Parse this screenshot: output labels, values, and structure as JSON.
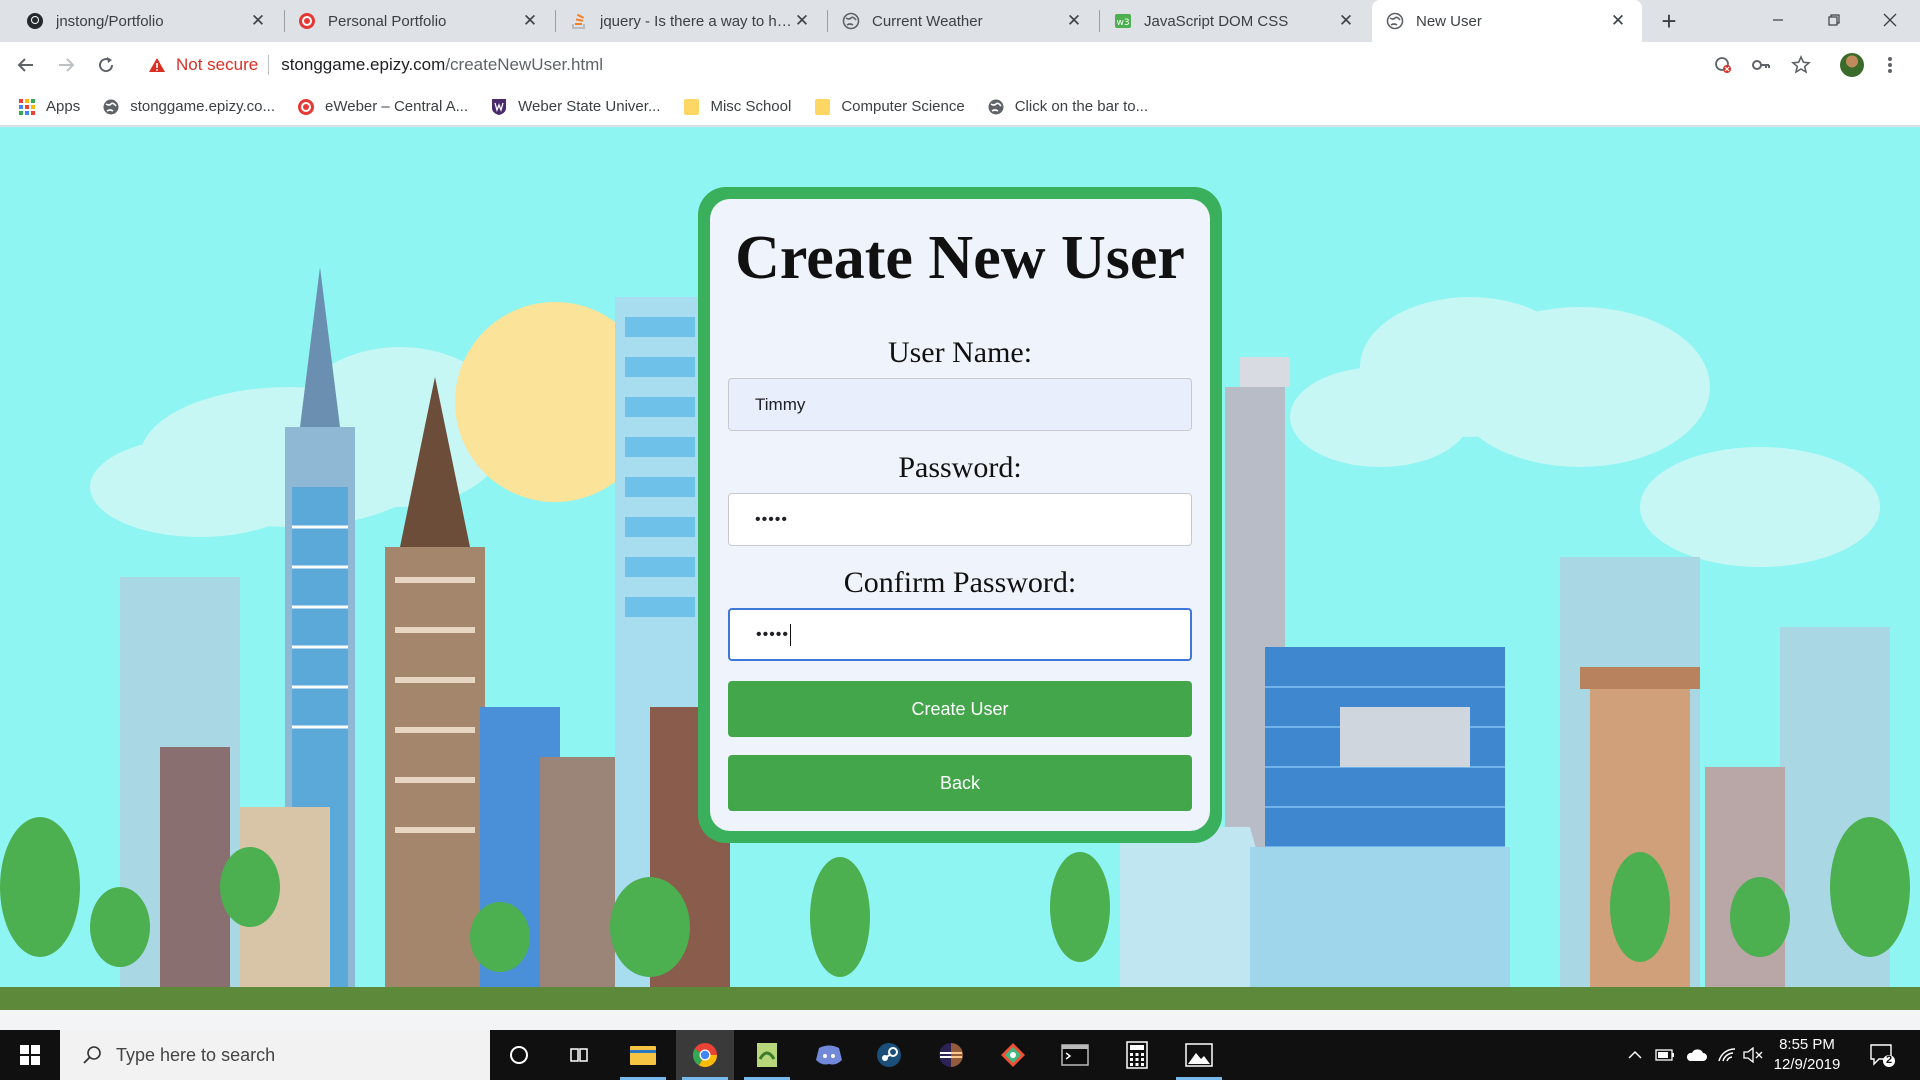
{
  "browser": {
    "tabs": [
      {
        "title": "jnstong/Portfolio",
        "favicon": "github-icon"
      },
      {
        "title": "Personal Portfolio",
        "favicon": "portfolio-icon"
      },
      {
        "title": "jquery - Is there a way to hide",
        "favicon": "stackoverflow-icon"
      },
      {
        "title": "Current Weather",
        "favicon": "globe-icon"
      },
      {
        "title": "JavaScript DOM CSS",
        "favicon": "w3schools-icon"
      },
      {
        "title": "New User",
        "favicon": "globe-icon",
        "active": true
      }
    ],
    "address": {
      "security_label": "Not secure",
      "host": "stonggame.epizy.com",
      "path": "/createNewUser.html"
    },
    "bookmarks": [
      {
        "label": "Apps",
        "icon": "apps-icon"
      },
      {
        "label": "stonggame.epizy.co...",
        "icon": "globe-icon"
      },
      {
        "label": "eWeber – Central A...",
        "icon": "eweber-icon"
      },
      {
        "label": "Weber State Univer...",
        "icon": "weber-shield-icon"
      },
      {
        "label": "Misc School",
        "icon": "folder-icon"
      },
      {
        "label": "Computer Science",
        "icon": "folder-icon"
      },
      {
        "label": "Click on the bar to...",
        "icon": "globe-icon"
      }
    ]
  },
  "form": {
    "title": "Create New User",
    "username_label": "User Name:",
    "username_value": "Timmy",
    "password_label": "Password:",
    "password_value": "•••••",
    "confirm_label": "Confirm Password:",
    "confirm_value": "•••••",
    "create_button": "Create User",
    "back_button": "Back"
  },
  "taskbar": {
    "search_placeholder": "Type here to search",
    "time": "8:55 PM",
    "date": "12/9/2019",
    "notification_count": "2"
  },
  "colors": {
    "sky": "#8ff5f2",
    "card_border": "#3bb05c",
    "button": "#44a64b",
    "focus": "#3e78d6"
  }
}
